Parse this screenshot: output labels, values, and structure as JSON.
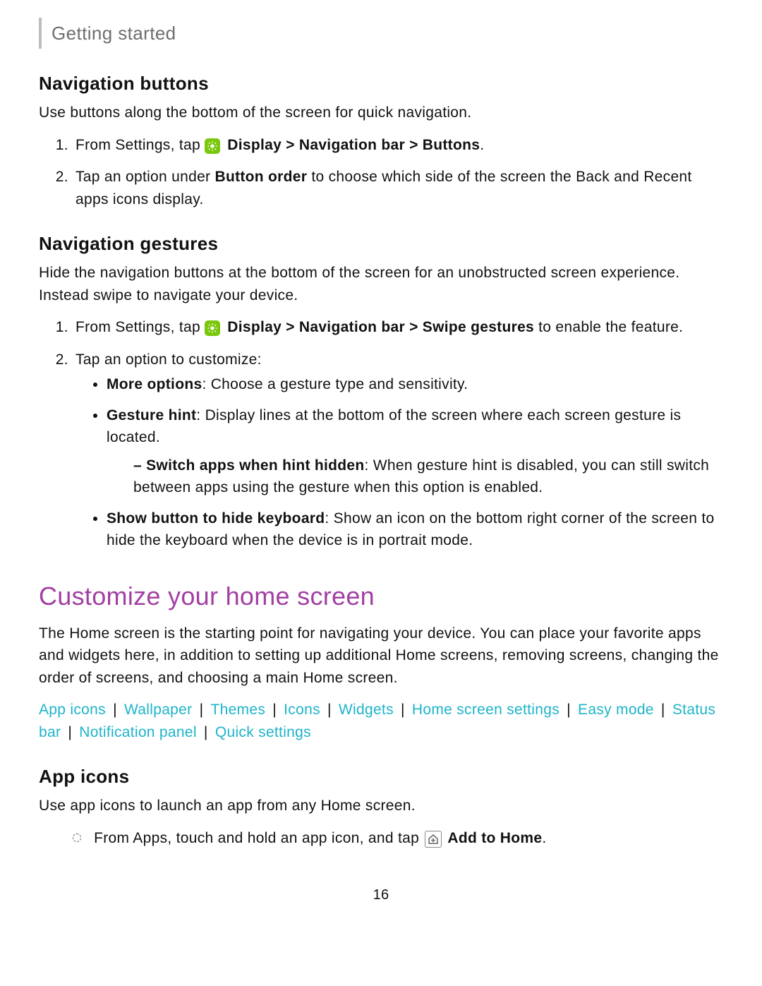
{
  "header": "Getting started",
  "nav_buttons": {
    "title": "Navigation buttons",
    "intro": "Use buttons along the bottom of the screen for quick navigation.",
    "step1_pre": "From Settings, tap ",
    "step1_bold": "Display > Navigation bar > Buttons",
    "step1_post": ".",
    "step2_a": "Tap an option under ",
    "step2_bold": "Button order",
    "step2_b": " to choose which side of the screen the Back and Recent apps icons display."
  },
  "nav_gestures": {
    "title": "Navigation gestures",
    "intro": "Hide the navigation buttons at the bottom of the screen for an unobstructed screen experience. Instead swipe to navigate your device.",
    "step1_pre": "From Settings, tap ",
    "step1_bold": "Display > Navigation bar > Swipe gestures",
    "step1_post": " to enable the feature.",
    "step2": "Tap an option to customize:",
    "more_opts_label": "More options",
    "more_opts_text": ": Choose a gesture type and sensitivity.",
    "gesture_hint_label": "Gesture hint",
    "gesture_hint_text": ": Display lines at the bottom of the screen where each screen gesture is located.",
    "switch_apps_label": "Switch apps when hint hidden",
    "switch_apps_text": ": When gesture hint is disabled, you can still switch between apps using the gesture when this option is enabled.",
    "show_button_label": "Show button to hide keyboard",
    "show_button_text": ": Show an icon on the bottom right corner of the screen to hide the keyboard when the device is in portrait mode."
  },
  "customize": {
    "title": "Customize your home screen",
    "intro": "The Home screen is the starting point for navigating your device. You can place your favorite apps and widgets here, in addition to setting up additional Home screens, removing screens, changing the order of screens, and choosing a main Home screen.",
    "links": [
      "App icons",
      "Wallpaper",
      "Themes",
      "Icons",
      "Widgets",
      "Home screen settings",
      "Easy mode",
      "Status bar",
      "Notification panel",
      "Quick settings"
    ]
  },
  "app_icons": {
    "title": "App icons",
    "intro": "Use app icons to launch an app from any Home screen.",
    "step_pre": "From Apps, touch and hold an app icon, and tap ",
    "step_bold": "Add to Home",
    "step_post": "."
  },
  "page_number": "16"
}
